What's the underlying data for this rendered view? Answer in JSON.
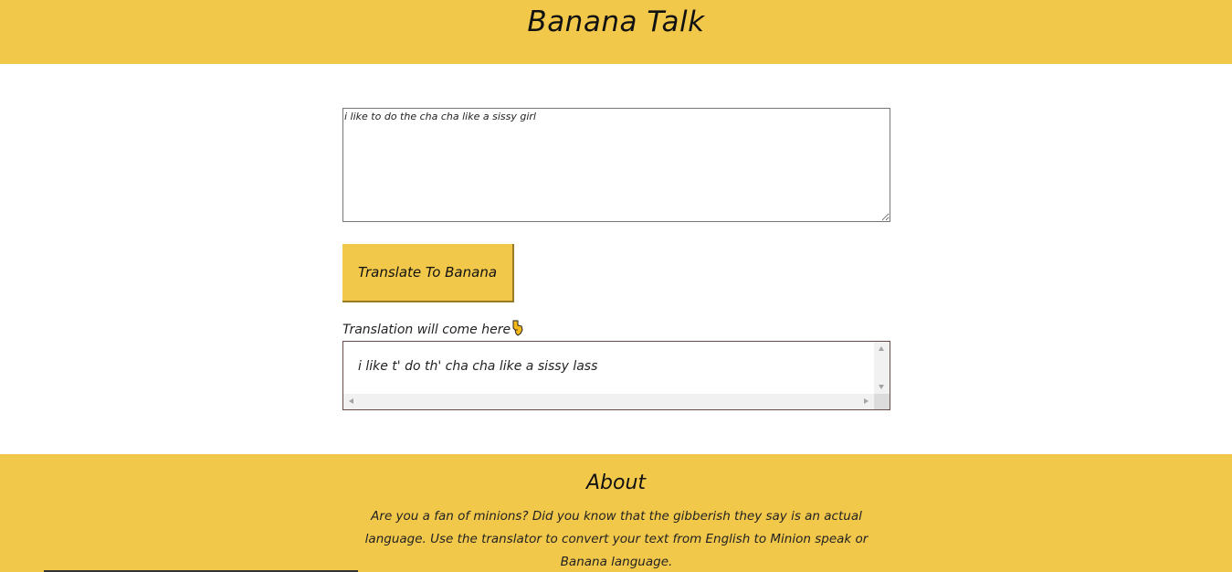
{
  "header": {
    "title": "Banana Talk"
  },
  "input": {
    "value": "i like to do the cha cha like a sissy girl"
  },
  "translate_button": {
    "label": "Translate To Banana"
  },
  "output": {
    "label": "Translation will come here",
    "text": "i like t' do th' cha cha like a sissy lass",
    "pointer_icon": "pointing-down-hand-icon"
  },
  "about": {
    "heading": "About",
    "body": "Are you a fan of minions? Did you know that the gibberish they say is an actual language. Use the translator to convert your text from English to Minion speak or Banana language."
  },
  "colors": {
    "accent": "#f2c84b",
    "text": "#111111",
    "background": "#ffffff"
  }
}
